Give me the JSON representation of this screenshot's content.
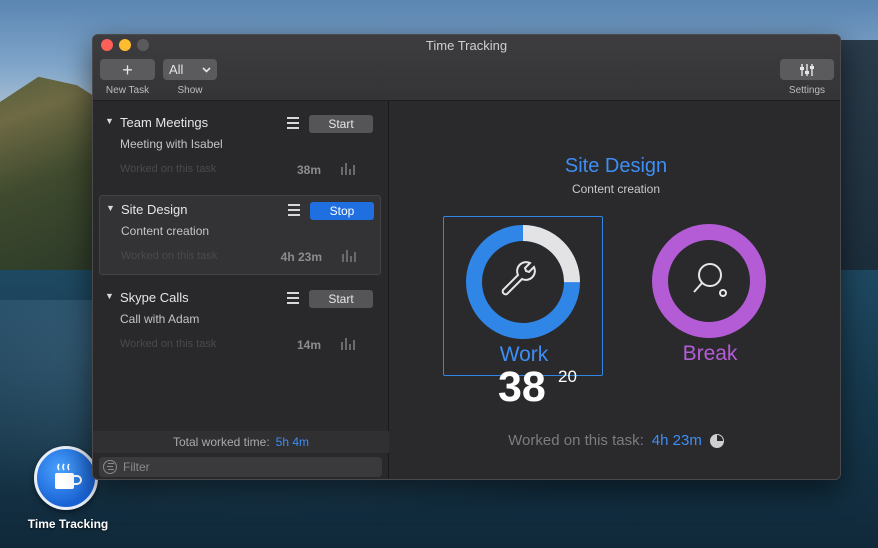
{
  "app": {
    "window_title": "Time Tracking",
    "dock_label": "Time Tracking"
  },
  "toolbar": {
    "new_task_icon": "+",
    "new_task_label": "New Task",
    "show_value": "All",
    "show_label": "Show",
    "settings_label": "Settings"
  },
  "tasks": [
    {
      "name": "Team Meetings",
      "subtitle": "Meeting with Isabel",
      "worked_label": "Worked on this task",
      "time": "38m",
      "button": "Start"
    },
    {
      "name": "Site Design",
      "subtitle": "Content creation",
      "worked_label": "Worked on this task",
      "time": "4h 23m",
      "button": "Stop"
    },
    {
      "name": "Skype Calls",
      "subtitle": "Call with Adam",
      "worked_label": "Worked on this task",
      "time": "14m",
      "button": "Start"
    }
  ],
  "footer": {
    "total_label": "Total worked time:",
    "total_value": "5h 4m",
    "filter_placeholder": "Filter"
  },
  "main": {
    "title": "Site Design",
    "subtitle": "Content creation",
    "work_label": "Work",
    "break_label": "Break",
    "work_progress": 0.25,
    "timer_minutes": "38",
    "timer_seconds": "20",
    "worked_label": "Worked on this task:",
    "worked_value": "4h 23m"
  },
  "colors": {
    "accent": "#3d8ef5",
    "work_ring": "#2f86e6",
    "break_ring": "#b45cd6",
    "stop_button": "#1f6fe0"
  },
  "icons": [
    "plus-icon",
    "chevron-down-icon",
    "sliders-icon",
    "hamburger-icon",
    "bar-chart-icon",
    "filter-icon",
    "wrench-icon",
    "ping-pong-icon",
    "pie-chart-icon",
    "coffee-cup-icon"
  ]
}
